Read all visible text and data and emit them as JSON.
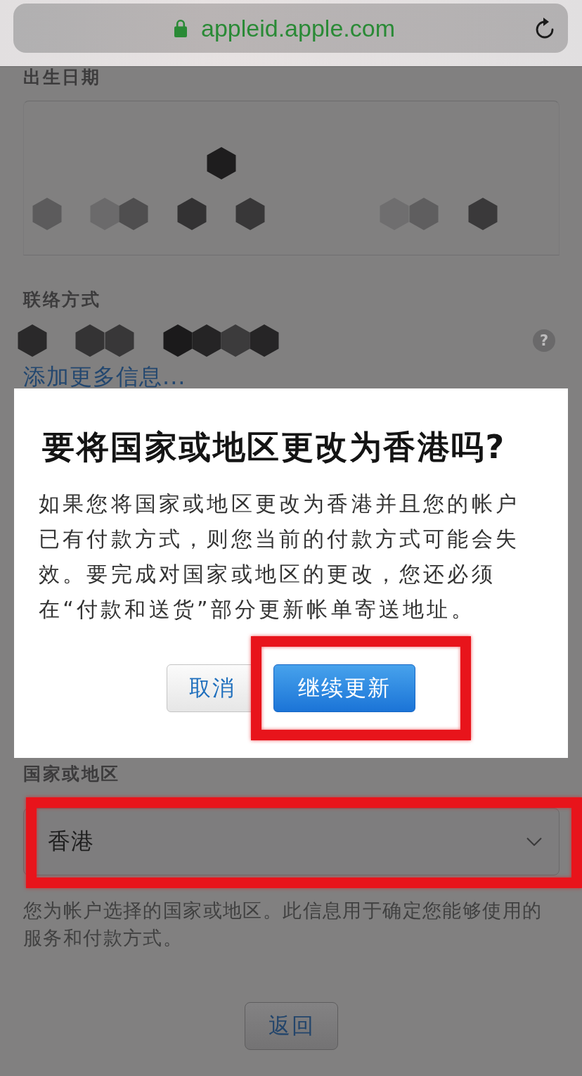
{
  "browser": {
    "url": "appleid.apple.com",
    "secure": true
  },
  "form": {
    "birth_date": {
      "label": "出生日期"
    },
    "contact": {
      "label": "联络方式",
      "help": "?",
      "add_more_link": "添加更多信息..."
    },
    "country": {
      "label": "国家或地区",
      "value": "香港",
      "highlighted": true,
      "description": "您为帐户选择的国家或地区。此信息用于确定您能够使用的服务和付款方式。"
    },
    "back_button": "返回"
  },
  "dialog": {
    "title": "要将国家或地区更改为香港吗?",
    "message": "如果您将国家或地区更改为香港并且您的帐户已有付款方式，则您当前的付款方式可能会失效。要完成对国家或地区的更改，您还必须在“付款和送货”部分更新帐单寄送地址。",
    "buttons": [
      {
        "label": "取消",
        "kind": "secondary",
        "highlighted": false
      },
      {
        "label": "继续更新",
        "kind": "primary",
        "highlighted": true
      }
    ]
  }
}
